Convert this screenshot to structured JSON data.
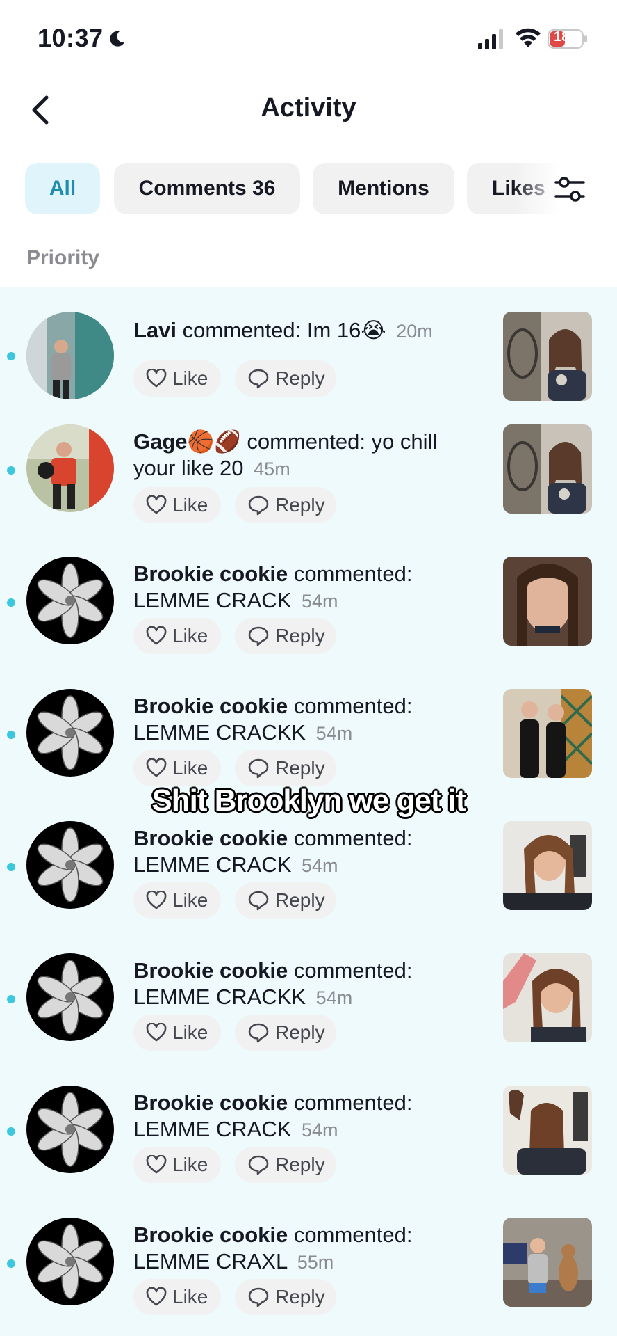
{
  "status_bar": {
    "time": "10:37",
    "battery": "18"
  },
  "header": {
    "title": "Activity"
  },
  "tabs": [
    {
      "label": "All",
      "active": true
    },
    {
      "label": "Comments 36",
      "active": false
    },
    {
      "label": "Mentions",
      "active": false
    },
    {
      "label": "Likes",
      "active": false
    }
  ],
  "section_label": "Priority",
  "notifications": [
    {
      "user": "Lavi",
      "action": "commented:",
      "comment": "Im 16😭",
      "time": "20m",
      "like": "Like",
      "reply": "Reply"
    },
    {
      "user": "Gage🏀🏈",
      "action": "commented:",
      "comment": "yo chill your like 20",
      "time": "45m",
      "like": "Like",
      "reply": "Reply"
    },
    {
      "user": "Brookie cookie",
      "action": "commented:",
      "comment": "LEMME CRACK",
      "time": "54m",
      "like": "Like",
      "reply": "Reply"
    },
    {
      "user": "Brookie cookie",
      "action": "commented:",
      "comment": "LEMME CRACKK",
      "time": "54m",
      "like": "Like",
      "reply": "Reply"
    },
    {
      "user": "Brookie cookie",
      "action": "commented:",
      "comment": "LEMME CRACK",
      "time": "54m",
      "like": "Like",
      "reply": "Reply"
    },
    {
      "user": "Brookie cookie",
      "action": "commented:",
      "comment": "LEMME CRACKK",
      "time": "54m",
      "like": "Like",
      "reply": "Reply"
    },
    {
      "user": "Brookie cookie",
      "action": "commented:",
      "comment": "LEMME CRACK",
      "time": "54m",
      "like": "Like",
      "reply": "Reply"
    },
    {
      "user": "Brookie cookie",
      "action": "commented:",
      "comment": "LEMME CRAXL",
      "time": "55m",
      "like": "Like",
      "reply": "Reply"
    }
  ],
  "overlay_caption": "Shit Brooklyn we get it",
  "colors": {
    "accent": "#1f8db0",
    "active_tab_bg": "#dff5fb",
    "unread_dot": "#3bc8de",
    "list_bg": "#eefafc",
    "battery_red": "#e04848"
  }
}
